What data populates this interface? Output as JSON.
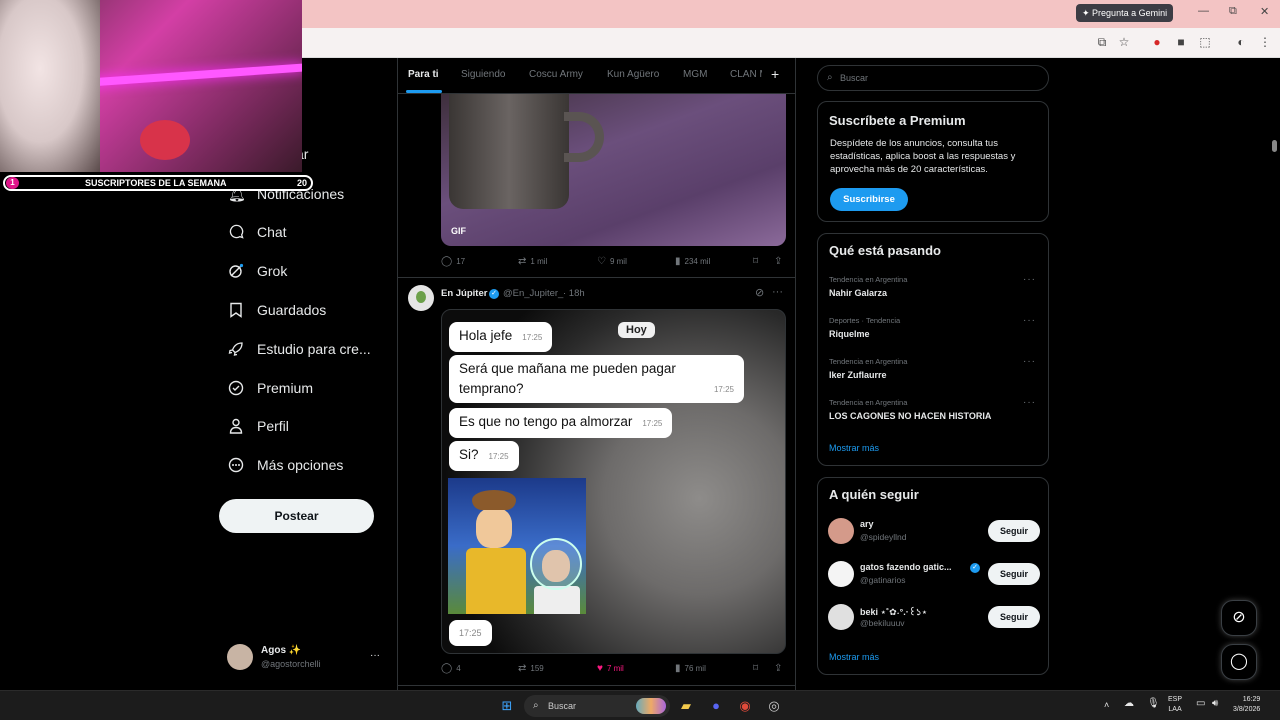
{
  "browser": {
    "gemini_label": "Pregunta a Gemini",
    "win_controls": [
      "—",
      "⧉",
      "✕"
    ]
  },
  "stream": {
    "subs_number_left": "1",
    "subs_label": "SUSCRIPTORES DE LA SEMANA",
    "subs_number_right": "20"
  },
  "nav": {
    "partial_label": "ar",
    "items": [
      {
        "label": "Notificaciones",
        "icon": "bell-icon"
      },
      {
        "label": "Chat",
        "icon": "chat-icon"
      },
      {
        "label": "Grok",
        "icon": "grok-icon"
      },
      {
        "label": "Guardados",
        "icon": "bookmark-icon"
      },
      {
        "label": "Estudio para cre...",
        "icon": "rocket-icon"
      },
      {
        "label": "Premium",
        "icon": "verified-icon"
      },
      {
        "label": "Perfil",
        "icon": "person-icon"
      },
      {
        "label": "Más opciones",
        "icon": "more-circle-icon"
      }
    ],
    "post_label": "Postear",
    "me": {
      "name": "Agos ✨",
      "handle": "@agostorchelli"
    }
  },
  "feed": {
    "tabs": [
      "Para ti",
      "Siguiendo",
      "Coscu Army",
      "Kun Agüero",
      "MGM",
      "CLAN M"
    ],
    "tweet1": {
      "gif_tag": "GIF",
      "replies": "17",
      "reposts": "1 mil",
      "likes": "9 mil",
      "views": "234 mil"
    },
    "tweet2": {
      "name": "En Júpiter",
      "handle": "@En_Jupiter_",
      "time": "· 18h",
      "chat": {
        "day": "Hoy",
        "messages": [
          {
            "text": "Hola jefe",
            "time": "17:25"
          },
          {
            "text": "Será que mañana me pueden pagar temprano?",
            "time": "17:25"
          },
          {
            "text": "Es que no tengo pa almorzar",
            "time": "17:25"
          },
          {
            "text": "Si?",
            "time": "17:25"
          }
        ],
        "sticker_time": "17:25"
      },
      "replies": "4",
      "reposts": "159",
      "likes": "7 mil",
      "views": "76 mil",
      "like_color": "#f91880"
    }
  },
  "sidebar": {
    "search_placeholder": "Buscar",
    "premium": {
      "title": "Suscríbete a Premium",
      "body": "Despídete de los anuncios, consulta tus estadísticas, aplica boost a las respuestas y aprovecha más de 20 características.",
      "button": "Suscribirse"
    },
    "trends": {
      "title": "Qué está pasando",
      "items": [
        {
          "meta": "Tendencia en Argentina",
          "name": "Nahir Galarza"
        },
        {
          "meta": "Deportes · Tendencia",
          "name": "Riquelme"
        },
        {
          "meta": "Tendencia en Argentina",
          "name": "Iker Zuflaurre"
        },
        {
          "meta": "Tendencia en Argentina",
          "name": "LOS CAGONES NO HACEN HISTORIA"
        }
      ],
      "more": "Mostrar más"
    },
    "follow": {
      "title": "A quién seguir",
      "items": [
        {
          "name": "ary",
          "handle": "@spideyllnd",
          "button": "Seguir"
        },
        {
          "name": "gatos fazendo gatic...",
          "handle": "@gatinarios",
          "button": "Seguir"
        },
        {
          "name": "beki ⋆˚✿˖°.·꒰১⋆",
          "handle": "@bekiluuuv",
          "button": "Seguir"
        }
      ],
      "more": "Mostrar más"
    }
  },
  "taskbar": {
    "search_label": "Buscar",
    "lang": "ESP",
    "lang_sub": "LAA",
    "time": "16:29",
    "date": "3/8/2026"
  },
  "colors": {
    "accent": "#1d9bf0",
    "bg": "#000000",
    "border": "#2f3336",
    "like": "#f91880"
  }
}
